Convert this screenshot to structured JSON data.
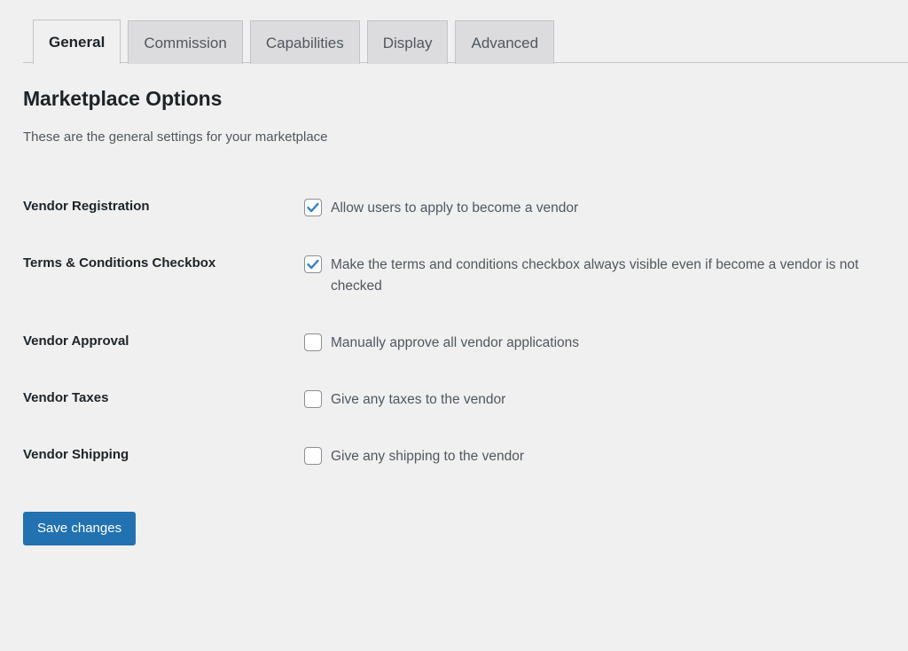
{
  "tabs": [
    {
      "label": "General",
      "active": true
    },
    {
      "label": "Commission",
      "active": false
    },
    {
      "label": "Capabilities",
      "active": false
    },
    {
      "label": "Display",
      "active": false
    },
    {
      "label": "Advanced",
      "active": false
    }
  ],
  "page": {
    "title": "Marketplace Options",
    "description": "These are the general settings for your marketplace"
  },
  "settings": [
    {
      "label": "Vendor Registration",
      "field_label": "Allow users to apply to become a vendor",
      "checked": true
    },
    {
      "label": "Terms & Conditions Checkbox",
      "field_label": "Make the terms and conditions checkbox always visible even if become a vendor is not checked",
      "checked": true
    },
    {
      "label": "Vendor Approval",
      "field_label": "Manually approve all vendor applications",
      "checked": false
    },
    {
      "label": "Vendor Taxes",
      "field_label": "Give any taxes to the vendor",
      "checked": false
    },
    {
      "label": "Vendor Shipping",
      "field_label": "Give any shipping to the vendor",
      "checked": false
    }
  ],
  "actions": {
    "save_label": "Save changes"
  },
  "colors": {
    "background": "#f0f0f1",
    "accent": "#2271b1",
    "checkmark": "#3582c4",
    "label_text": "#1d2327",
    "body_text": "#50575e",
    "border": "#c3c4c7"
  }
}
